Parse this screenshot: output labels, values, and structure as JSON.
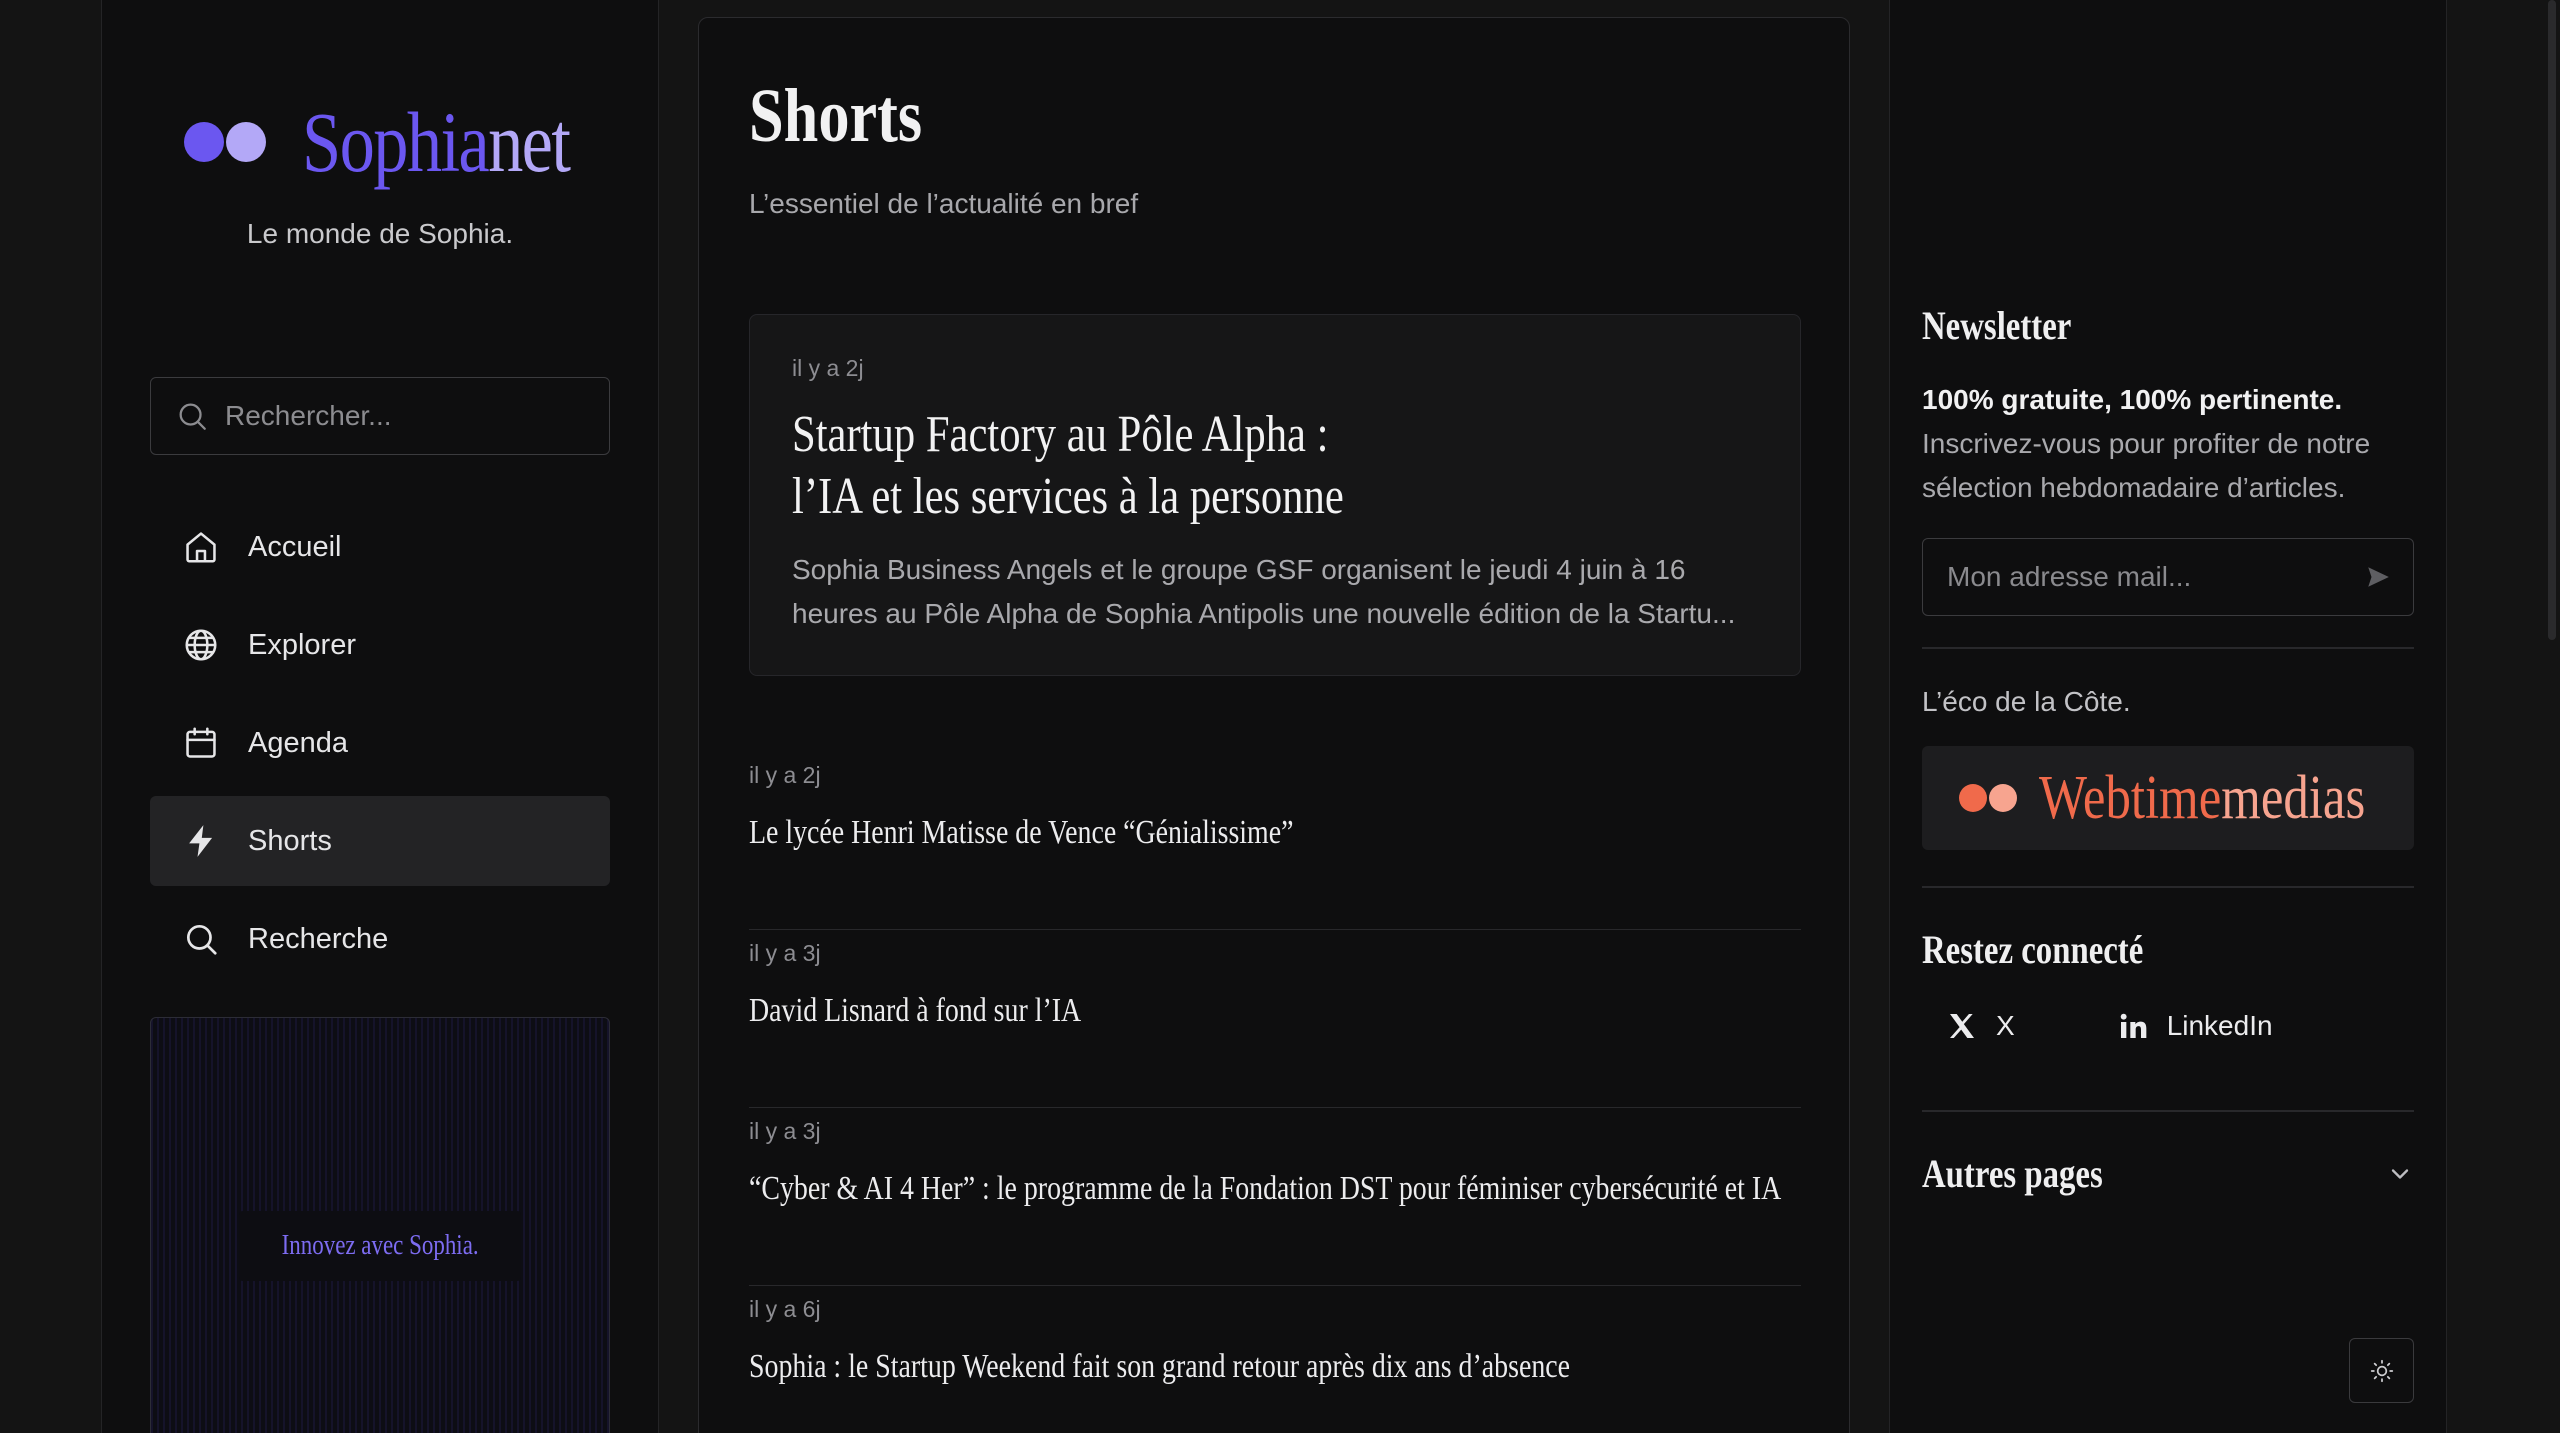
{
  "colors": {
    "accent": "#6b57f0",
    "accent_light": "#b3a8f7",
    "brand_orange": "#f06a4b",
    "brand_orange_light": "#f7a48f"
  },
  "sidebar": {
    "logo": {
      "part1": "Sophia",
      "part2": "net"
    },
    "tagline": "Le monde de Sophia.",
    "search_placeholder": "Rechercher...",
    "nav": [
      {
        "label": "Accueil",
        "icon": "home-icon",
        "active": false
      },
      {
        "label": "Explorer",
        "icon": "globe-icon",
        "active": false
      },
      {
        "label": "Agenda",
        "icon": "calendar-icon",
        "active": false
      },
      {
        "label": "Shorts",
        "icon": "lightning-icon",
        "active": true
      },
      {
        "label": "Recherche",
        "icon": "search-icon",
        "active": false
      }
    ],
    "promo_label": "Innovez avec Sophia."
  },
  "main": {
    "title": "Shorts",
    "subtitle": "L’essentiel de l’actualité en bref",
    "featured": {
      "time": "il y a 2j",
      "title_line1": "Startup Factory au Pôle Alpha :",
      "title_line2": "l’IA et les services à la personne",
      "desc": "Sophia Business Angels et le groupe GSF organisent le jeudi 4 juin à 16 heures au Pôle Alpha de Sophia Antipolis une nouvelle édition de la Startu..."
    },
    "items": [
      {
        "time": "il y a 2j",
        "title": "Le lycée Henri Matisse de Vence “Génialissime”"
      },
      {
        "time": "il y a 3j",
        "title": "David Lisnard à fond sur l’IA"
      },
      {
        "time": "il y a 3j",
        "title": "“Cyber & AI 4 Her” : le programme de la Fondation DST pour féminiser cybersécurité et IA"
      },
      {
        "time": "il y a 6j",
        "title": "Sophia : le Startup Weekend fait son grand retour après dix ans d’absence"
      }
    ]
  },
  "right": {
    "newsletter_heading": "Newsletter",
    "newsletter_strong": "100% gratuite, 100% pertinente.",
    "newsletter_text": "Inscrivez-vous pour profiter de notre sélection hebdomadaire d’articles.",
    "mail_placeholder": "Mon adresse mail...",
    "eco_label": "L’éco de la Côte.",
    "eco_brand": {
      "part1": "Webtime",
      "part2": "medias"
    },
    "connect_heading": "Restez connecté",
    "social": [
      {
        "label": "X",
        "icon": "x-logo-icon"
      },
      {
        "label": "LinkedIn",
        "icon": "linkedin-icon"
      }
    ],
    "other_pages": "Autres pages"
  }
}
